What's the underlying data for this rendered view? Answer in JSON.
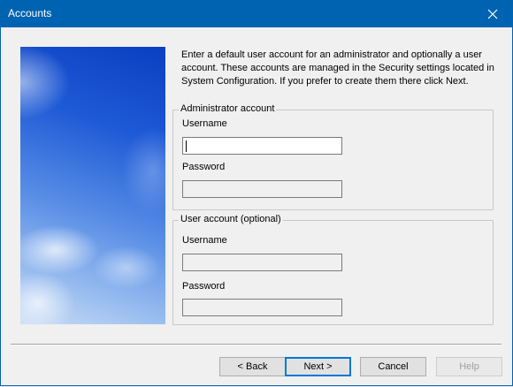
{
  "window": {
    "title": "Accounts",
    "close_icon": "close-icon"
  },
  "intro_text": "Enter a default user account for an administrator and optionally a user account. These accounts are managed in the Security settings located in System Configuration. If you prefer to create them there click Next.",
  "admin_group": {
    "legend": "Administrator account",
    "username_label": "Username",
    "username_value": "",
    "password_label": "Password",
    "password_value": ""
  },
  "user_group": {
    "legend": "User account (optional)",
    "username_label": "Username",
    "username_value": "",
    "password_label": "Password",
    "password_value": ""
  },
  "buttons": {
    "back": "< Back",
    "next": "Next >",
    "cancel": "Cancel",
    "help": "Help"
  },
  "colors": {
    "titlebar": "#0063b1",
    "default_button_border": "#0078d7"
  }
}
